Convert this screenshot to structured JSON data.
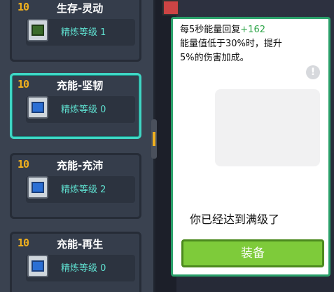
{
  "cards": [
    {
      "level": "10",
      "name": "生存-灵动",
      "refine": "精炼等级 1",
      "icon": "leaf-chip-icon",
      "selected": false
    },
    {
      "level": "10",
      "name": "充能-坚韧",
      "refine": "精炼等级 0",
      "icon": "battery-chip-icon",
      "selected": true
    },
    {
      "level": "10",
      "name": "充能-充沛",
      "refine": "精炼等级 2",
      "icon": "battery-chip-icon",
      "selected": false
    },
    {
      "level": "10",
      "name": "充能-再生",
      "refine": "精炼等级 0",
      "icon": "battery-chip-icon",
      "selected": false
    }
  ],
  "detail": {
    "desc_line1_prefix": "每5秒能量回复",
    "desc_line1_value": "+162",
    "desc_line2": "能量值低于30%时，提升",
    "desc_line3": "5%的伤害加成。",
    "max_text": "你已经达到满级了",
    "equip_label": "装备"
  },
  "colors": {
    "accent_selected": "#3fd6c4",
    "level_gold": "#f0b01e",
    "refine_teal": "#5fe0d0",
    "equip_green": "#7ecb3a",
    "value_green": "#2fa64a"
  }
}
